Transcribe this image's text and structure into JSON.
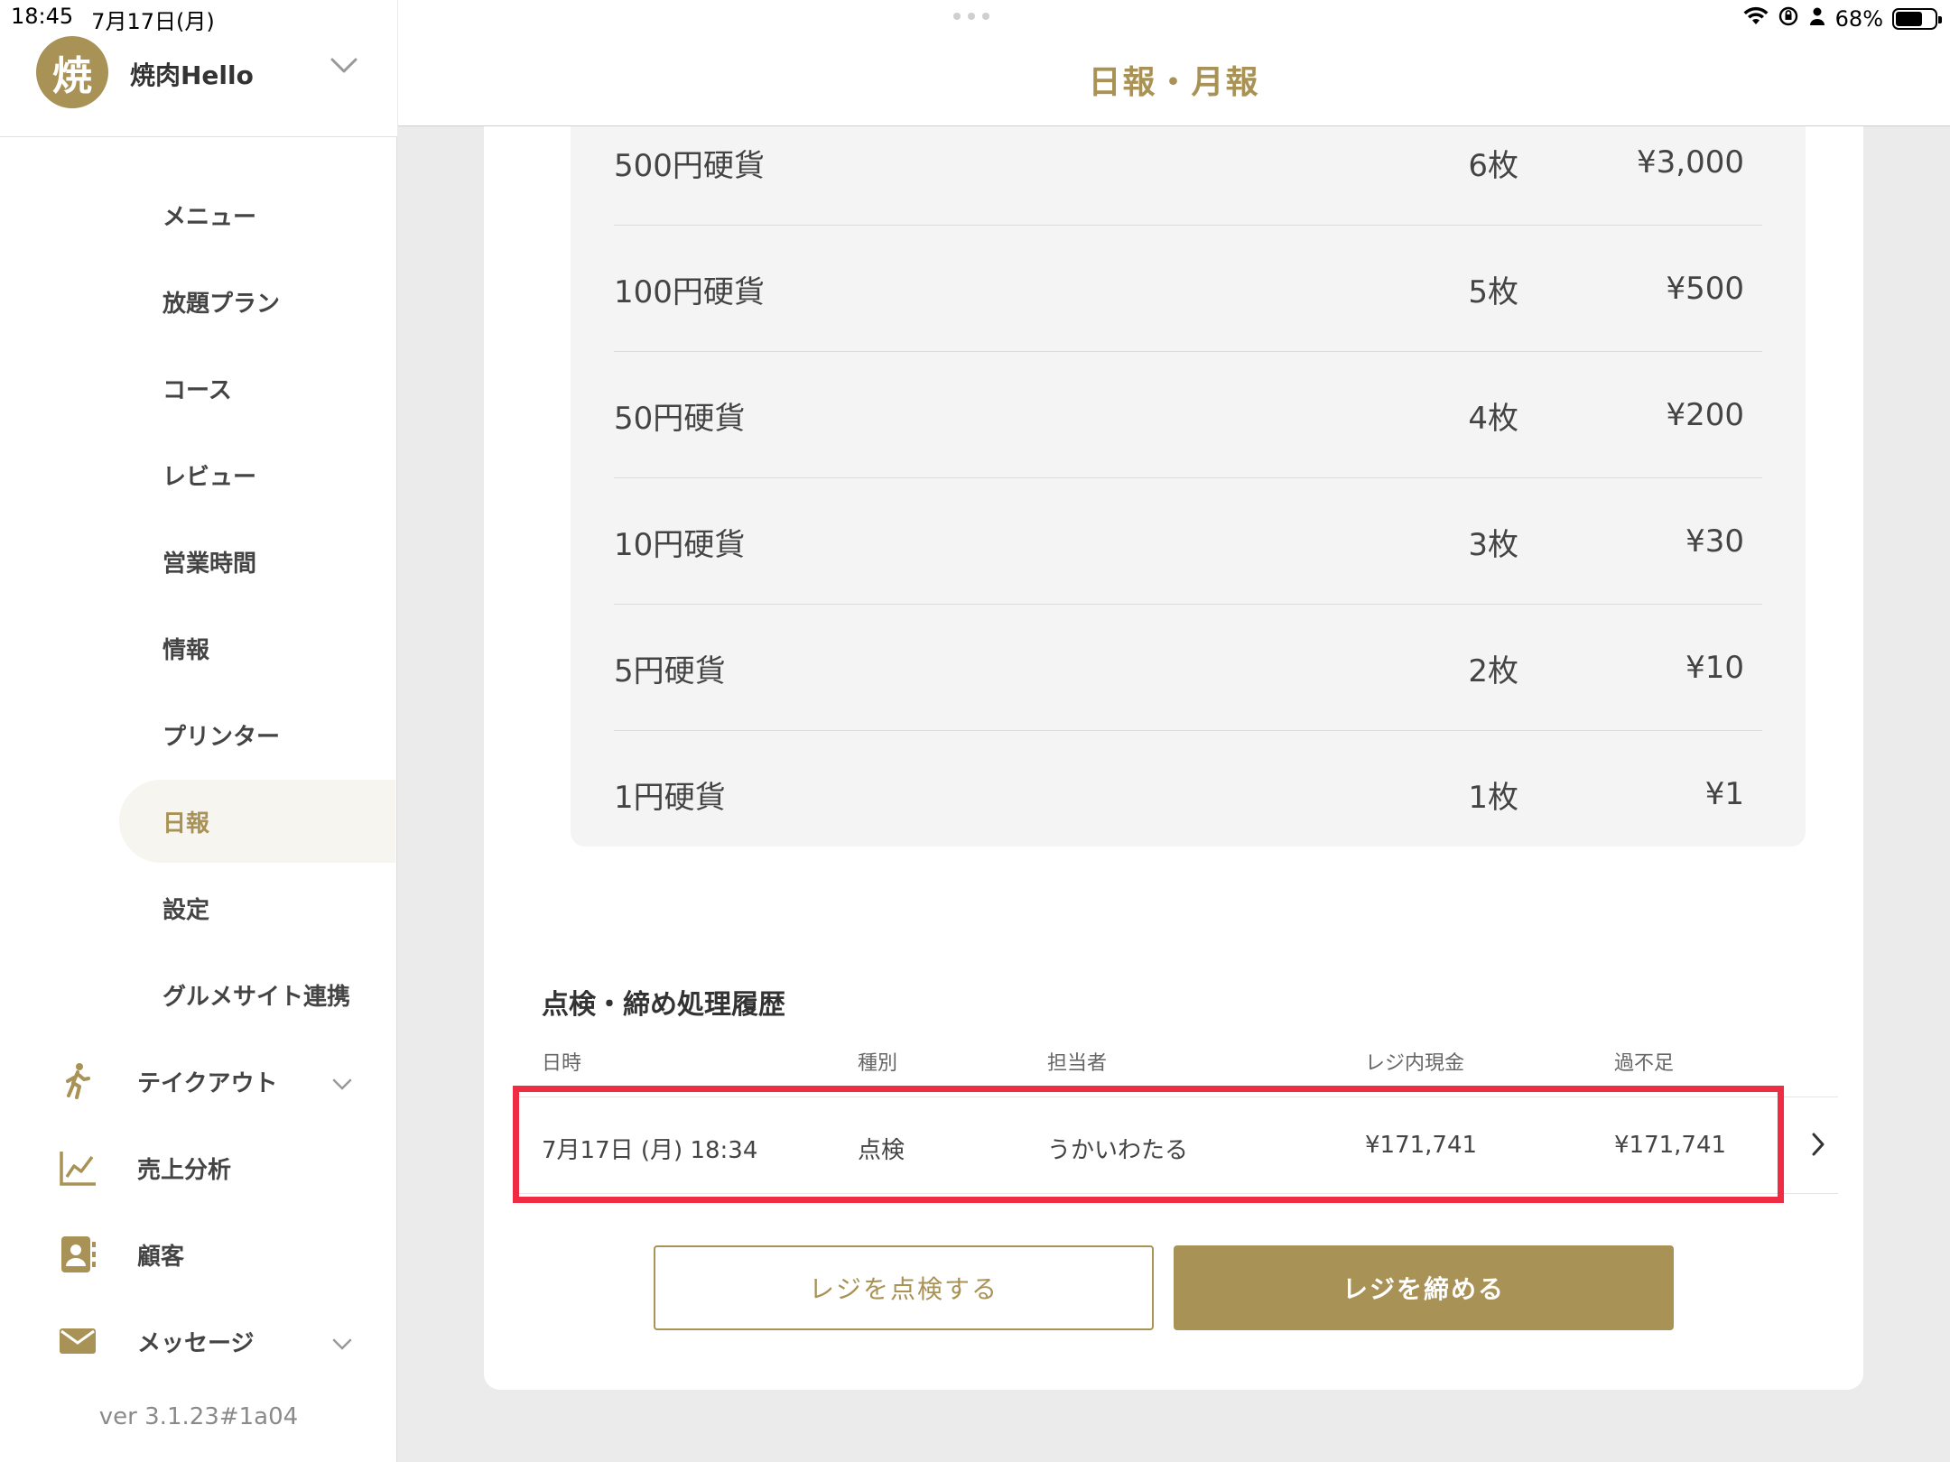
{
  "status_bar": {
    "time": "18:45",
    "date": "7月17日(月)",
    "battery": "68%",
    "battery_level": 0.68
  },
  "sidebar": {
    "store": {
      "avatar_text": "焼",
      "name": "焼肉Hello"
    },
    "menu_items": [
      {
        "label": "メニュー",
        "active": false
      },
      {
        "label": "放題プラン",
        "active": false
      },
      {
        "label": "コース",
        "active": false
      },
      {
        "label": "レビュー",
        "active": false
      },
      {
        "label": "営業時間",
        "active": false
      },
      {
        "label": "情報",
        "active": false
      },
      {
        "label": "プリンター",
        "active": false
      },
      {
        "label": "日報",
        "active": true
      },
      {
        "label": "設定",
        "active": false
      },
      {
        "label": "グルメサイト連携",
        "active": false
      }
    ],
    "sections": [
      {
        "label": "テイクアウト",
        "icon": "person-walking-icon",
        "expandable": true
      },
      {
        "label": "売上分析",
        "icon": "line-chart-icon",
        "expandable": false
      },
      {
        "label": "顧客",
        "icon": "contact-book-icon",
        "expandable": false
      },
      {
        "label": "メッセージ",
        "icon": "envelope-icon",
        "expandable": true
      }
    ],
    "version": "ver 3.1.23#1a04"
  },
  "header": {
    "title": "日報・月報"
  },
  "coins": [
    {
      "name": "500円硬貨",
      "count": "6枚",
      "amount": "¥3,000"
    },
    {
      "name": "100円硬貨",
      "count": "5枚",
      "amount": "¥500"
    },
    {
      "name": "50円硬貨",
      "count": "4枚",
      "amount": "¥200"
    },
    {
      "name": "10円硬貨",
      "count": "3枚",
      "amount": "¥30"
    },
    {
      "name": "5円硬貨",
      "count": "2枚",
      "amount": "¥10"
    },
    {
      "name": "1円硬貨",
      "count": "1枚",
      "amount": "¥1"
    }
  ],
  "history": {
    "title": "点検・締め処理履歴",
    "columns": [
      "日時",
      "種別",
      "担当者",
      "レジ内現金",
      "過不足"
    ],
    "rows": [
      {
        "datetime": "7月17日 (月) 18:34",
        "type": "点検",
        "staff": "うかいわたる",
        "cash": "¥171,741",
        "diff": "¥171,741"
      }
    ]
  },
  "buttons": {
    "inspect": "レジを点検する",
    "close": "レジを締める"
  },
  "colors": {
    "accent": "#a99256",
    "highlight": "#ee2c44"
  }
}
